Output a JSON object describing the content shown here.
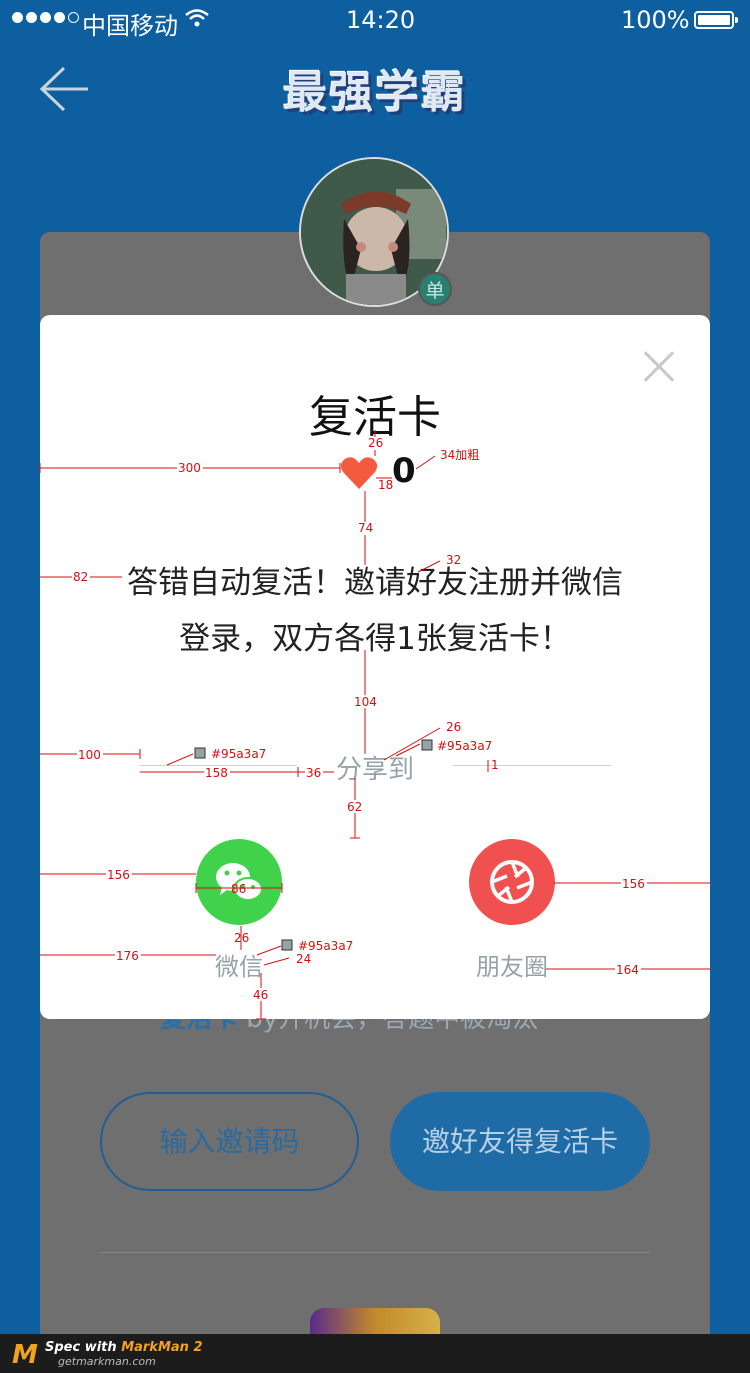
{
  "status_bar": {
    "carrier": "中国移动",
    "time": "14:20",
    "battery": "100%"
  },
  "nav": {
    "title": "最强学霸"
  },
  "avatar": {
    "badge": "单"
  },
  "background_page": {
    "hint_highlight": "复活卡",
    "hint_rest": "by开机会，答题中被淘汰",
    "invite_code_button": "输入邀请码",
    "invite_friend_button": "邀好友得复活卡"
  },
  "modal": {
    "title": "复活卡",
    "card_count": "0",
    "description_line1": "答错自动复活！邀请好友注册并微信",
    "description_line2": "登录，双方各得1张复活卡！",
    "share_label": "分享到",
    "share_options": [
      {
        "label": "微信",
        "icon": "wechat-icon",
        "color": "#3fd24a"
      },
      {
        "label": "朋友圈",
        "icon": "moments-icon",
        "color": "#f0504f"
      }
    ]
  },
  "spec_annotations": {
    "title_gap": "26",
    "left_300": "300",
    "heart_gap": "18",
    "count_font": "34加粗",
    "gap_74": "74",
    "left_82": "82",
    "desc_font": "32",
    "gap_104": "104",
    "left_100": "100",
    "line_color": "#95a3a7",
    "share_font": "26",
    "share_color": "#95a3a7",
    "line_len": "158",
    "gap_36": "36",
    "line_thickness": "1",
    "gap_62": "62",
    "left_156": "156",
    "icon_size": "86",
    "right_156": "156",
    "gap_26": "26",
    "caption_color": "#95a3a7",
    "caption_font": "24",
    "left_176": "176",
    "right_164": "164",
    "gap_46": "46"
  },
  "footer": {
    "spec_prefix": "Spec with ",
    "spec_brand": "MarkMan 2",
    "url": "getmarkman.com"
  },
  "colors": {
    "brand_blue": "#0e5f9f",
    "wechat_green": "#3fd24a",
    "moments_red": "#f0504f",
    "heart": "#f35b3f",
    "annotation": "#d61010"
  }
}
